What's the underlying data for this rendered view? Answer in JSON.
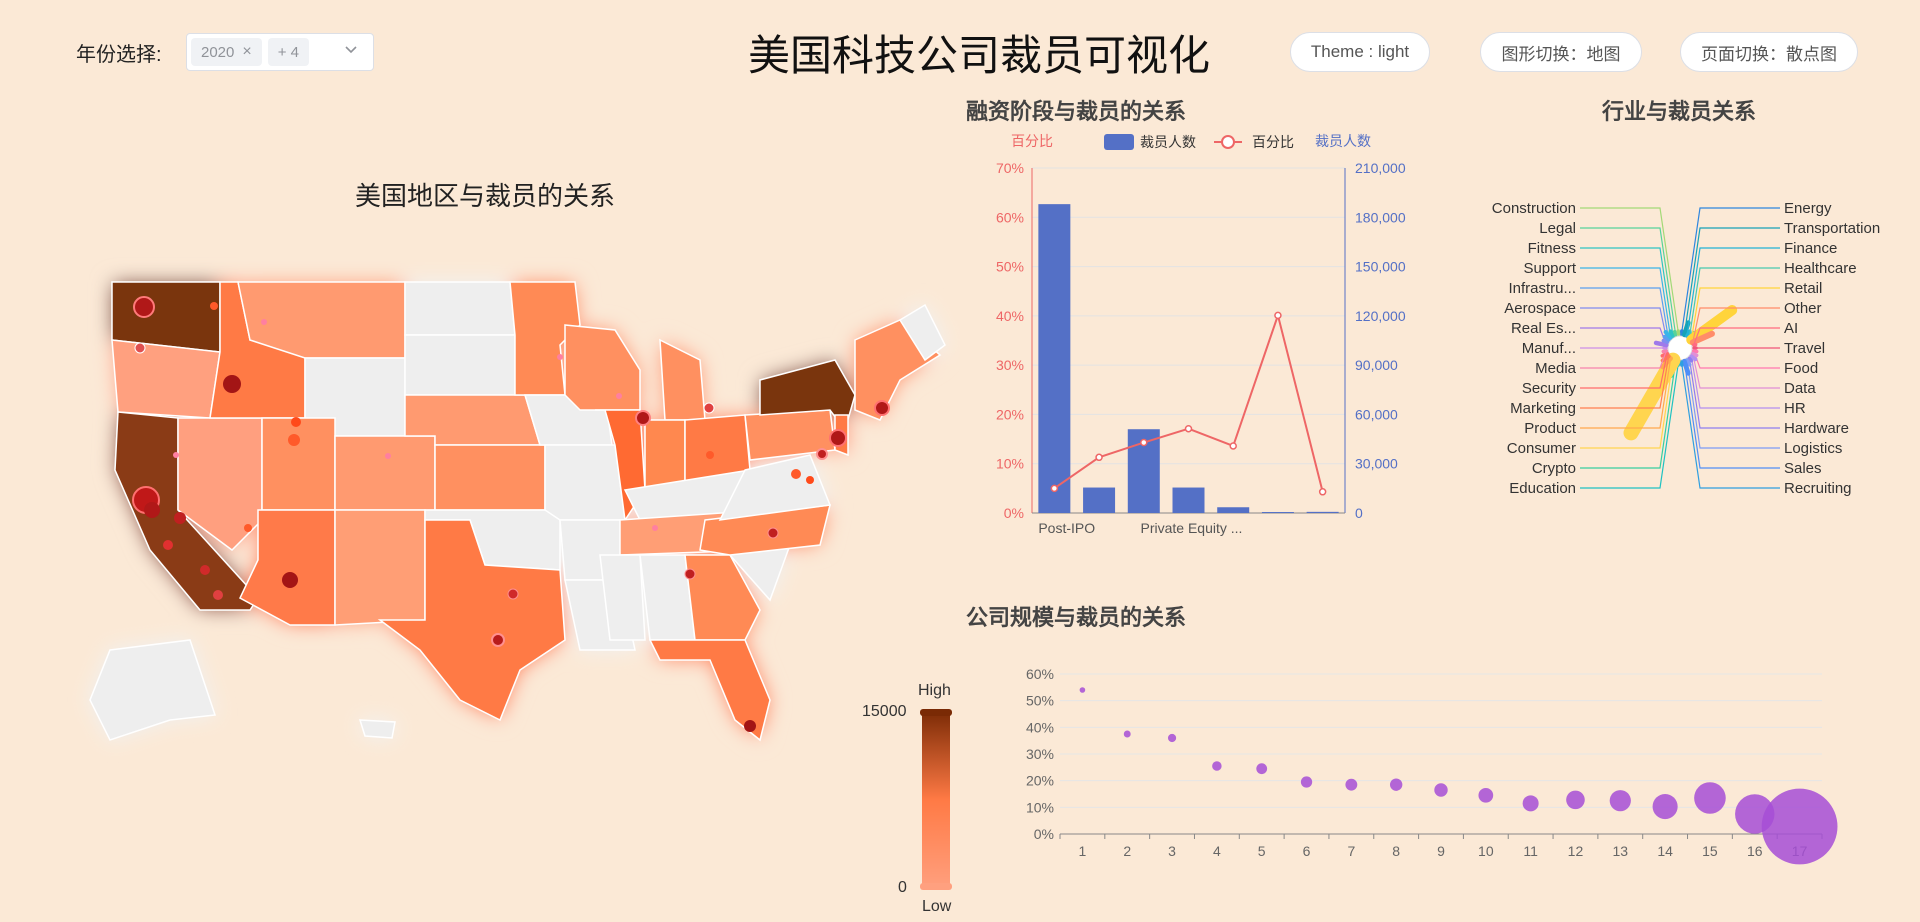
{
  "header": {
    "year_label": "年份选择:",
    "year_tag": "2020",
    "year_more": "+ 4",
    "title": "美国科技公司裁员可视化",
    "theme_btn": "Theme : light",
    "chart_switch_btn": "图形切换：地图",
    "page_switch_btn": "页面切换：散点图"
  },
  "colors": {
    "background": "#fbe9d6",
    "bar": "#5470c6",
    "line": "#ee6666",
    "bubble": "#a64ed6",
    "map_high": "#7a2a05",
    "map_low": "#ff9f7f"
  },
  "map": {
    "title": "美国地区与裁员的关系",
    "legend_high": "High",
    "legend_low": "Low",
    "legend_max": "15000",
    "legend_min": "0"
  },
  "chart_data": [
    {
      "type": "bar",
      "title": "融资阶段与裁员的关系",
      "legend": [
        "裁员人数",
        "百分比"
      ],
      "left_axis_name": "百分比",
      "right_axis_name": "裁员人数",
      "left_ticks": [
        "0%",
        "10%",
        "20%",
        "30%",
        "40%",
        "50%",
        "60%",
        "70%"
      ],
      "right_ticks": [
        "0",
        "30,000",
        "60,000",
        "90,000",
        "120,000",
        "150,000",
        "180,000",
        "210,000"
      ],
      "category_labels": [
        "Post-IPO",
        "Private Equity ..."
      ],
      "left_ylim": [
        0,
        70
      ],
      "right_ylim": [
        0,
        210000
      ],
      "bar_values": [
        188000,
        15500,
        51000,
        15500,
        3500,
        600,
        700
      ],
      "line_values": [
        5,
        11.3,
        14.3,
        17.1,
        13.6,
        40.1,
        4.3
      ]
    },
    {
      "type": "radial-bar",
      "title": "行业与裁员关系",
      "categories": [
        "Energy",
        "Transportation",
        "Finance",
        "Healthcare",
        "Retail",
        "Other",
        "AI",
        "Travel",
        "Food",
        "Data",
        "HR",
        "Hardware",
        "Logistics",
        "Sales",
        "Recruiting",
        "Education",
        "Crypto",
        "Consumer",
        "Product",
        "Marketing",
        "Security",
        "Media",
        "Manuf...",
        "Real Es...",
        "Aerospace",
        "Infrastru...",
        "Support",
        "Fitness",
        "Legal",
        "Construction"
      ],
      "values": [
        3,
        12,
        5,
        6,
        48,
        20,
        2,
        2,
        3,
        4,
        5,
        3,
        5,
        12,
        3,
        3,
        14,
        80,
        11,
        7,
        5,
        3,
        2,
        10,
        4,
        5,
        7,
        5,
        3,
        3
      ],
      "colors": [
        "#2e86de",
        "#17a2b8",
        "#22b3d6",
        "#48c9b0",
        "#ffd43b",
        "#ff8c69",
        "#ff6b81",
        "#f0567a",
        "#ff79b0",
        "#e08fd6",
        "#b38ef0",
        "#8e7ef0",
        "#7d9cf5",
        "#4f8ef7",
        "#2f9fe0",
        "#1fc2c2",
        "#36cfa0",
        "#ffd54f",
        "#ffa94d",
        "#ff7f50",
        "#ff6b6b",
        "#f783ac",
        "#cc8ee8",
        "#9f7aea",
        "#7f8cf0",
        "#5aa0f0",
        "#3ab5e8",
        "#2fc4c4",
        "#57d39b",
        "#a3d977"
      ]
    },
    {
      "type": "scatter",
      "title": "公司规模与裁员的关系",
      "x": [
        1,
        2,
        3,
        4,
        5,
        6,
        7,
        8,
        9,
        10,
        11,
        12,
        13,
        14,
        15,
        16,
        17
      ],
      "y": [
        54,
        37.5,
        36,
        25.5,
        24.5,
        19.5,
        18.5,
        18.5,
        16.5,
        14.5,
        11.5,
        12.8,
        12.5,
        10.3,
        13.5,
        7.5,
        2.8
      ],
      "size": [
        1,
        1.5,
        2,
        2.5,
        3,
        3.2,
        3.4,
        3.6,
        4,
        4.5,
        5,
        6,
        7,
        8.5,
        11,
        14,
        28
      ],
      "y_ticks": [
        "0%",
        "10%",
        "20%",
        "30%",
        "40%",
        "50%",
        "60%"
      ],
      "ylim": [
        0,
        60
      ]
    }
  ]
}
